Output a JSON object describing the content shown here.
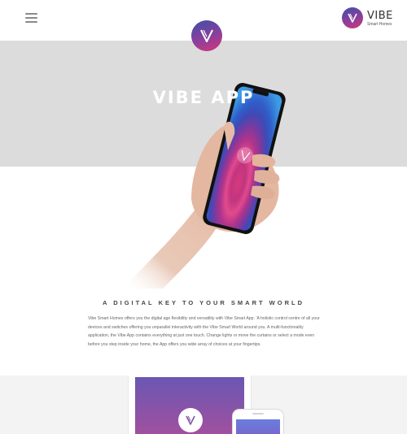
{
  "header": {
    "menu_icon": "hamburger-menu-icon",
    "brand": {
      "icon": "vibe-logo-icon",
      "name": "VIBE",
      "tagline": "Smart Homes"
    },
    "center_logo_icon": "vibe-logo-icon"
  },
  "hero": {
    "title": "VIBE APP",
    "image": "hand-holding-phone",
    "bg_color": "#dcdcdc"
  },
  "section": {
    "title": "A DIGITAL KEY TO YOUR SMART WORLD",
    "body": "Vibe Smart Homes offers you the digital age flexibility and versatility with Vibe Smart App. 'A holistic control centre of all your devices and switches offering you unparallel interactivity with the Vibe Smart World around you. A multi-functionality application, the Vibe App contains everything at just one touch. Change lights or move the curtains or select a mode even before you step inside your home, the App offers you wide array of choices at your fingertips."
  },
  "devices": {
    "tablet_icon": "vibe-logo-icon",
    "phone_icon": "phone-screen"
  },
  "colors": {
    "brand_blue": "#3e4fa8",
    "brand_purple": "#8a3f9c",
    "brand_pink": "#d43677",
    "text": "#444444"
  }
}
